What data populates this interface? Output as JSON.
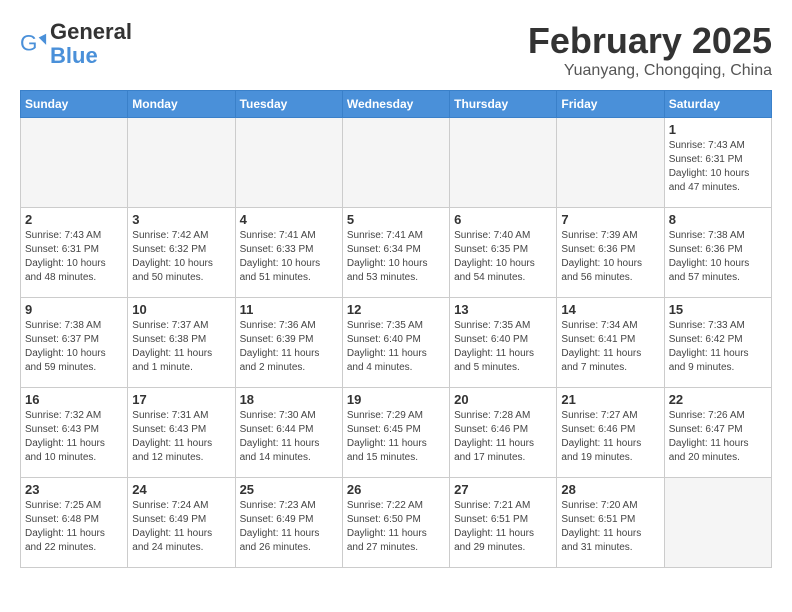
{
  "header": {
    "logo_general": "General",
    "logo_blue": "Blue",
    "month_title": "February 2025",
    "location": "Yuanyang, Chongqing, China"
  },
  "days_of_week": [
    "Sunday",
    "Monday",
    "Tuesday",
    "Wednesday",
    "Thursday",
    "Friday",
    "Saturday"
  ],
  "weeks": [
    [
      {
        "day": "",
        "info": ""
      },
      {
        "day": "",
        "info": ""
      },
      {
        "day": "",
        "info": ""
      },
      {
        "day": "",
        "info": ""
      },
      {
        "day": "",
        "info": ""
      },
      {
        "day": "",
        "info": ""
      },
      {
        "day": "1",
        "info": "Sunrise: 7:43 AM\nSunset: 6:31 PM\nDaylight: 10 hours and 47 minutes."
      }
    ],
    [
      {
        "day": "2",
        "info": "Sunrise: 7:43 AM\nSunset: 6:31 PM\nDaylight: 10 hours and 48 minutes."
      },
      {
        "day": "3",
        "info": "Sunrise: 7:42 AM\nSunset: 6:32 PM\nDaylight: 10 hours and 50 minutes."
      },
      {
        "day": "4",
        "info": "Sunrise: 7:41 AM\nSunset: 6:33 PM\nDaylight: 10 hours and 51 minutes."
      },
      {
        "day": "5",
        "info": "Sunrise: 7:41 AM\nSunset: 6:34 PM\nDaylight: 10 hours and 53 minutes."
      },
      {
        "day": "6",
        "info": "Sunrise: 7:40 AM\nSunset: 6:35 PM\nDaylight: 10 hours and 54 minutes."
      },
      {
        "day": "7",
        "info": "Sunrise: 7:39 AM\nSunset: 6:36 PM\nDaylight: 10 hours and 56 minutes."
      },
      {
        "day": "8",
        "info": "Sunrise: 7:38 AM\nSunset: 6:36 PM\nDaylight: 10 hours and 57 minutes."
      }
    ],
    [
      {
        "day": "9",
        "info": "Sunrise: 7:38 AM\nSunset: 6:37 PM\nDaylight: 10 hours and 59 minutes."
      },
      {
        "day": "10",
        "info": "Sunrise: 7:37 AM\nSunset: 6:38 PM\nDaylight: 11 hours and 1 minute."
      },
      {
        "day": "11",
        "info": "Sunrise: 7:36 AM\nSunset: 6:39 PM\nDaylight: 11 hours and 2 minutes."
      },
      {
        "day": "12",
        "info": "Sunrise: 7:35 AM\nSunset: 6:40 PM\nDaylight: 11 hours and 4 minutes."
      },
      {
        "day": "13",
        "info": "Sunrise: 7:35 AM\nSunset: 6:40 PM\nDaylight: 11 hours and 5 minutes."
      },
      {
        "day": "14",
        "info": "Sunrise: 7:34 AM\nSunset: 6:41 PM\nDaylight: 11 hours and 7 minutes."
      },
      {
        "day": "15",
        "info": "Sunrise: 7:33 AM\nSunset: 6:42 PM\nDaylight: 11 hours and 9 minutes."
      }
    ],
    [
      {
        "day": "16",
        "info": "Sunrise: 7:32 AM\nSunset: 6:43 PM\nDaylight: 11 hours and 10 minutes."
      },
      {
        "day": "17",
        "info": "Sunrise: 7:31 AM\nSunset: 6:43 PM\nDaylight: 11 hours and 12 minutes."
      },
      {
        "day": "18",
        "info": "Sunrise: 7:30 AM\nSunset: 6:44 PM\nDaylight: 11 hours and 14 minutes."
      },
      {
        "day": "19",
        "info": "Sunrise: 7:29 AM\nSunset: 6:45 PM\nDaylight: 11 hours and 15 minutes."
      },
      {
        "day": "20",
        "info": "Sunrise: 7:28 AM\nSunset: 6:46 PM\nDaylight: 11 hours and 17 minutes."
      },
      {
        "day": "21",
        "info": "Sunrise: 7:27 AM\nSunset: 6:46 PM\nDaylight: 11 hours and 19 minutes."
      },
      {
        "day": "22",
        "info": "Sunrise: 7:26 AM\nSunset: 6:47 PM\nDaylight: 11 hours and 20 minutes."
      }
    ],
    [
      {
        "day": "23",
        "info": "Sunrise: 7:25 AM\nSunset: 6:48 PM\nDaylight: 11 hours and 22 minutes."
      },
      {
        "day": "24",
        "info": "Sunrise: 7:24 AM\nSunset: 6:49 PM\nDaylight: 11 hours and 24 minutes."
      },
      {
        "day": "25",
        "info": "Sunrise: 7:23 AM\nSunset: 6:49 PM\nDaylight: 11 hours and 26 minutes."
      },
      {
        "day": "26",
        "info": "Sunrise: 7:22 AM\nSunset: 6:50 PM\nDaylight: 11 hours and 27 minutes."
      },
      {
        "day": "27",
        "info": "Sunrise: 7:21 AM\nSunset: 6:51 PM\nDaylight: 11 hours and 29 minutes."
      },
      {
        "day": "28",
        "info": "Sunrise: 7:20 AM\nSunset: 6:51 PM\nDaylight: 11 hours and 31 minutes."
      },
      {
        "day": "",
        "info": ""
      }
    ]
  ]
}
